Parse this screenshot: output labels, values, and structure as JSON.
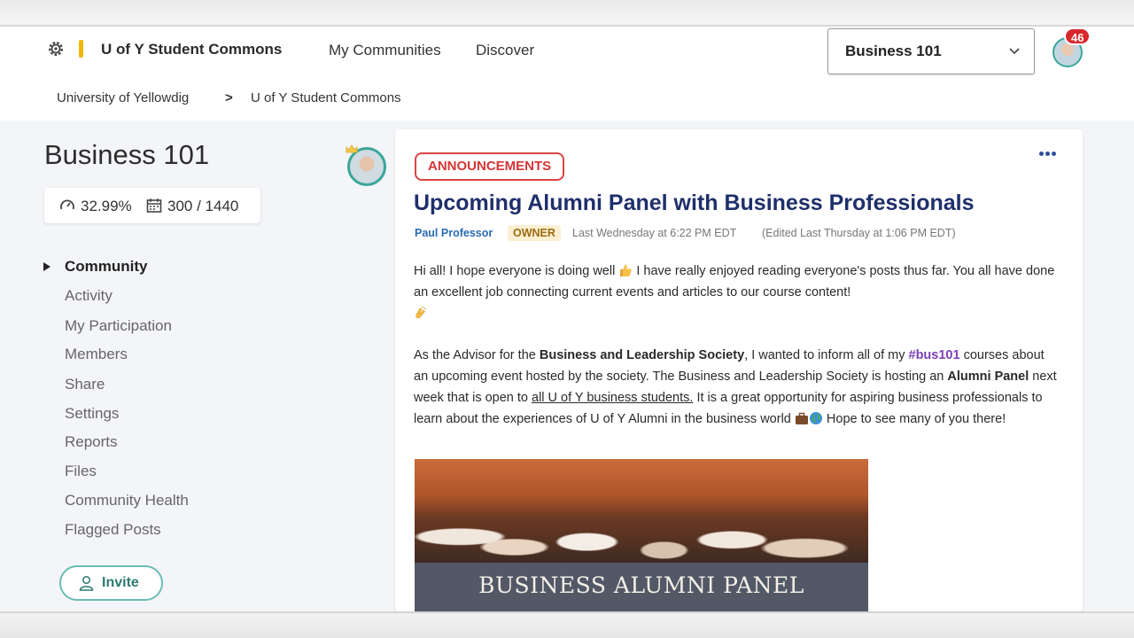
{
  "header": {
    "brand": "U of Y Student Commons",
    "nav": [
      "My Communities",
      "Discover"
    ],
    "course_select": "Business 101",
    "notification_count": "46"
  },
  "breadcrumb": {
    "root": "University of Yellowdig",
    "separator": ">",
    "current": "U of Y Student Commons"
  },
  "sidebar": {
    "title": "Business 101",
    "stats": {
      "participation": "32.99%",
      "points": "300 / 1440"
    },
    "items": [
      {
        "label": "Community"
      },
      {
        "label": "Activity"
      },
      {
        "label": "My Participation"
      },
      {
        "label": "Members"
      },
      {
        "label": "Share"
      },
      {
        "label": "Settings"
      },
      {
        "label": "Reports"
      },
      {
        "label": "Files"
      },
      {
        "label": "Community Health"
      },
      {
        "label": "Flagged Posts"
      }
    ],
    "invite_label": "Invite"
  },
  "post": {
    "tag": "ANNOUNCEMENTS",
    "title": "Upcoming Alumni Panel with Business Professionals",
    "author": "Paul Professor",
    "role": "OWNER",
    "time": "Last Wednesday at 6:22 PM EDT",
    "edited": "(Edited Last Thursday at 1:06 PM EDT)",
    "p1": {
      "a": "Hi all! I hope everyone is doing well",
      "b": " I have really enjoyed reading everyone's posts thus far. You all have done an excellent job connecting current events and articles to our course content!"
    },
    "p2": {
      "a": "As the Advisor for the ",
      "b": "Business and Leadership Society",
      "c": ", I wanted to inform all of my ",
      "hashtag": "#bus101",
      "d": " courses about an upcoming event hosted by the society. The Business and Leadership Society is hosting an ",
      "e": "Alumni Panel",
      "f": " next week that is open to ",
      "g": "all U of Y business students.",
      "h": " It is a great opportunity for aspiring business professionals to learn about the experiences of U of Y Alumni in the business world ",
      "i": " Hope to see many of you there!"
    },
    "image_caption": "BUSINESS ALUMNI PANEL"
  },
  "colors": {
    "accent_teal": "#3aa69a",
    "title_navy": "#1f2f6b",
    "announcement_red": "#d94545",
    "hashtag_purple": "#7d3fb5",
    "badge_red": "#d9282d"
  },
  "icons": [
    "gear-icon",
    "chevron-down-icon",
    "gauge-icon",
    "calendar-icon",
    "user-icon",
    "more-dots-icon",
    "thumbs-up-icon",
    "clapping-hands-icon",
    "briefcase-icon",
    "globe-icon",
    "crown-icon"
  ]
}
